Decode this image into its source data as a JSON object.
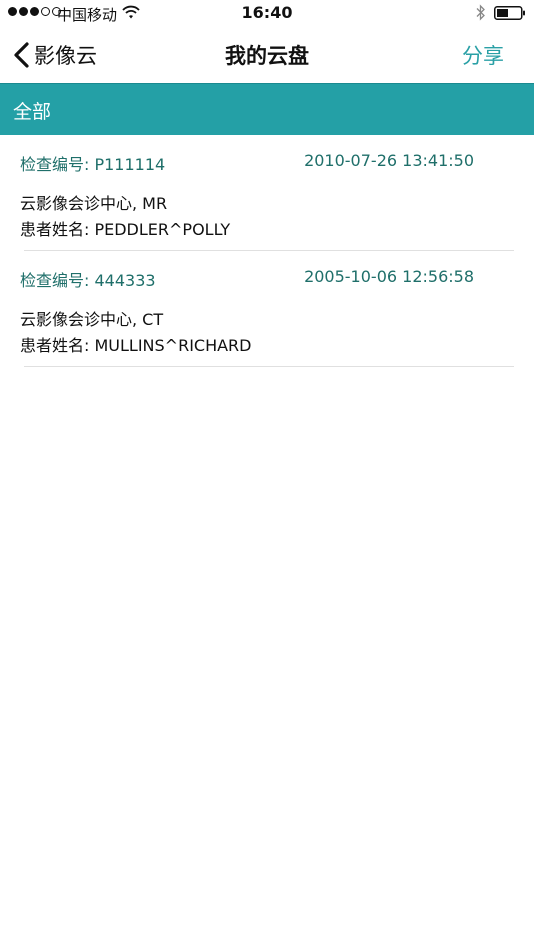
{
  "status_bar": {
    "carrier": "中国移动",
    "time": "16:40",
    "signal_icon": "signal-dots-icon",
    "wifi_icon": "wifi-icon",
    "bluetooth_icon": "bluetooth-icon",
    "battery_icon": "battery-icon"
  },
  "nav": {
    "back_label": "影像云",
    "title": "我的云盘",
    "share_label": "分享",
    "back_icon": "chevron-left-icon"
  },
  "category": {
    "label": "全部"
  },
  "records": [
    {
      "id": "检查编号: P111114",
      "time": "2010-07-26 13:41:50",
      "center": "云影像会诊中心, MR",
      "patient": "患者姓名: PEDDLER^POLLY"
    },
    {
      "id": "检查编号: 444333",
      "time": "2005-10-06 12:56:58",
      "center": "云影像会诊中心, CT",
      "patient": "患者姓名: MULLINS^RICHARD"
    }
  ],
  "colors": {
    "accent": "#24a0a6",
    "share": "#2aa0a6",
    "record_header": "#1f6f6a"
  }
}
